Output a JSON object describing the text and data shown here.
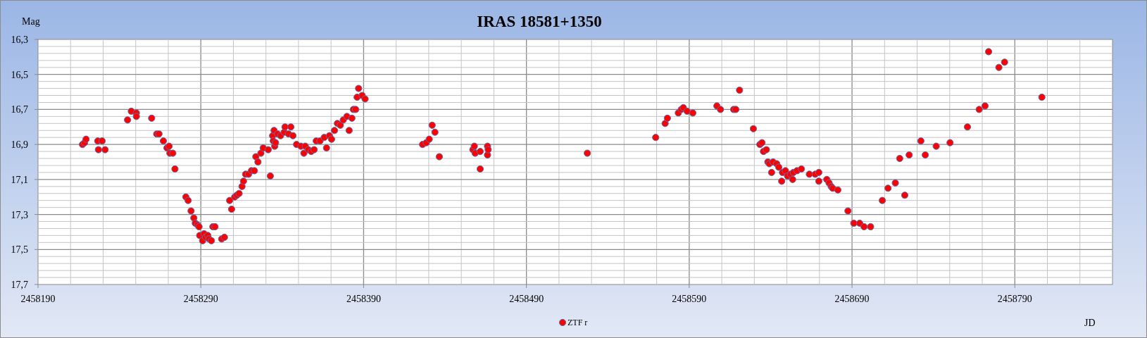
{
  "chart": {
    "chart_data": {
      "type": "scatter",
      "grid": true,
      "title": "IRAS 18581+1350",
      "xlabel": "JD",
      "ylabel": "Mag",
      "xlim": [
        2458190,
        2458850
      ],
      "ylim": [
        17.7,
        16.3
      ],
      "xticks": [
        2458190,
        2458290,
        2458390,
        2458490,
        2458590,
        2458690,
        2458790
      ],
      "yticks": [
        {
          "value": 16.3,
          "label": "16,3"
        },
        {
          "value": 16.5,
          "label": "16,5"
        },
        {
          "value": 16.7,
          "label": "16,7"
        },
        {
          "value": 16.9,
          "label": "16,9"
        },
        {
          "value": 17.1,
          "label": "17,1"
        },
        {
          "value": 17.3,
          "label": "17,3"
        },
        {
          "value": 17.5,
          "label": "17,5"
        },
        {
          "value": 17.7,
          "label": "17,7"
        }
      ],
      "x": [
        2458217.3,
        2458218.6,
        2458219.5,
        2458226.7,
        2458227.1,
        2458229.4,
        2458231.2,
        2458245,
        2458247.3,
        2458250.4,
        2458250.4,
        2458259.8,
        2458262.9,
        2458264.3,
        2458267,
        2458269.2,
        2458270.5,
        2458271,
        2458272.8,
        2458274.1,
        2458280.8,
        2458282.2,
        2458284,
        2458285.7,
        2458286.6,
        2458288,
        2458288.9,
        2458289.3,
        2458291.1,
        2458292,
        2458292.9,
        2458294.3,
        2458295.1,
        2458296.5,
        2458297.4,
        2458298.7,
        2458302.8,
        2458304.5,
        2458307.7,
        2458308.9,
        2458310.8,
        2458312.1,
        2458313.5,
        2458315.3,
        2458316.2,
        2458317.5,
        2458319.3,
        2458321.1,
        2458322.9,
        2458323.8,
        2458325.1,
        2458326.9,
        2458328.3,
        2458331.4,
        2458332.7,
        2458334.1,
        2458334.5,
        2458335,
        2458335.4,
        2458335.9,
        2458337.2,
        2458339,
        2458341.2,
        2458341.7,
        2458343.9,
        2458345.3,
        2458346.6,
        2458348.8,
        2458351.5,
        2458353.3,
        2458354.2,
        2458356,
        2458357.8,
        2458359.6,
        2458360.9,
        2458363.2,
        2458365.8,
        2458367.2,
        2458369,
        2458370.3,
        2458372.1,
        2458373.9,
        2458375.7,
        2458377.5,
        2458379.7,
        2458381.1,
        2458382.8,
        2458383.7,
        2458385.1,
        2458386,
        2458386.9,
        2458389.1,
        2458390.9,
        2458426.2,
        2458428.5,
        2458430.3,
        2458432.1,
        2458433.8,
        2458436.5,
        2458457.1,
        2458458,
        2458458.5,
        2458461.6,
        2458461.6,
        2458466.1,
        2458466.1,
        2458466.5,
        2458527.4,
        2458569.4,
        2458575.2,
        2458576.6,
        2458583.3,
        2458585.1,
        2458586.4,
        2458588.7,
        2458592.2,
        2458607,
        2458609.2,
        2458617.3,
        2458618.6,
        2458620.9,
        2458629.4,
        2458633.4,
        2458634.7,
        2458635.6,
        2458637.4,
        2458638.3,
        2458639.2,
        2458640.6,
        2458641.5,
        2458643.7,
        2458645,
        2458646.8,
        2458647.3,
        2458649.1,
        2458650.4,
        2458652.2,
        2458653.5,
        2458654,
        2458656.2,
        2458658.9,
        2458663.8,
        2458667.4,
        2458669.6,
        2458669.6,
        2458674.5,
        2458675.9,
        2458677.2,
        2458678.1,
        2458681.3,
        2458687.5,
        2458691.1,
        2458694.7,
        2458697.4,
        2458701.4,
        2458708.6,
        2458712.1,
        2458716.6,
        2458719.3,
        2458722.4,
        2458725.1,
        2458732.3,
        2458735,
        2458741.7,
        2458750.2,
        2458760.9,
        2458768.1,
        2458771.7,
        2458773.9,
        2458780.2,
        2458783.7,
        2458806.6
      ],
      "series": [
        {
          "name": "ZTF r",
          "color": "#ff0000",
          "values": [
            16.9,
            16.89,
            16.87,
            16.88,
            16.93,
            16.88,
            16.93,
            16.76,
            16.71,
            16.72,
            16.74,
            16.75,
            16.84,
            16.84,
            16.88,
            16.92,
            16.91,
            16.95,
            16.95,
            17.04,
            17.2,
            17.22,
            17.28,
            17.32,
            17.35,
            17.36,
            17.37,
            17.42,
            17.45,
            17.41,
            17.43,
            17.42,
            17.44,
            17.45,
            17.37,
            17.37,
            17.44,
            17.43,
            17.22,
            17.27,
            17.2,
            17.19,
            17.18,
            17.14,
            17.11,
            17.07,
            17.07,
            17.05,
            17.05,
            16.97,
            17,
            16.95,
            16.92,
            16.93,
            17.08,
            16.85,
            16.88,
            16.82,
            16.91,
            16.89,
            16.84,
            16.85,
            16.83,
            16.8,
            16.84,
            16.8,
            16.85,
            16.9,
            16.91,
            16.95,
            16.91,
            16.93,
            16.94,
            16.93,
            16.88,
            16.88,
            16.86,
            16.92,
            16.85,
            16.87,
            16.82,
            16.78,
            16.79,
            16.76,
            16.74,
            16.82,
            16.75,
            16.7,
            16.7,
            16.63,
            16.58,
            16.62,
            16.64,
            16.9,
            16.89,
            16.87,
            16.79,
            16.83,
            16.97,
            16.93,
            16.91,
            16.95,
            16.94,
            17.04,
            16.91,
            16.96,
            16.93,
            16.95,
            16.86,
            16.78,
            16.75,
            16.72,
            16.7,
            16.69,
            16.71,
            16.72,
            16.68,
            16.7,
            16.7,
            16.7,
            16.59,
            16.81,
            16.9,
            16.89,
            16.94,
            16.93,
            17,
            17.01,
            17.06,
            17,
            17.01,
            17.03,
            17.11,
            17.06,
            17.05,
            17.08,
            17.07,
            17.1,
            17.06,
            17.05,
            17.04,
            17.07,
            17.07,
            17.06,
            17.11,
            17.1,
            17.12,
            17.14,
            17.15,
            17.16,
            17.28,
            17.35,
            17.35,
            17.37,
            17.37,
            17.22,
            17.15,
            17.12,
            16.98,
            17.19,
            16.96,
            16.88,
            16.96,
            16.91,
            16.89,
            16.8,
            16.7,
            16.68,
            16.37,
            16.46,
            16.43,
            16.63
          ]
        }
      ]
    }
  }
}
